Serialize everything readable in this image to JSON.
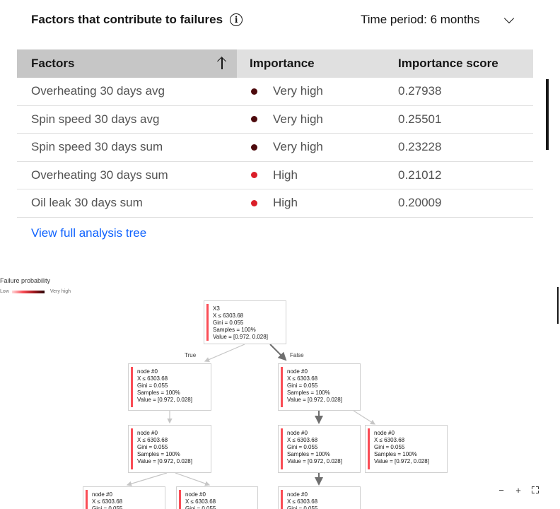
{
  "card": {
    "title": "Factors that contribute to failures",
    "info_glyph": "i",
    "period_label": "Time period: 6 months"
  },
  "table": {
    "headers": {
      "factors": "Factors",
      "importance": "Importance",
      "score": "Importance score"
    },
    "rows": [
      {
        "factor": "Overheating 30 days avg",
        "importance": "Very high",
        "score": "0.27938",
        "dot_color": "#4d0a0d"
      },
      {
        "factor": "Spin speed 30 days avg",
        "importance": "Very high",
        "score": "0.25501",
        "dot_color": "#4d0a0d"
      },
      {
        "factor": "Spin speed 30 days sum",
        "importance": "Very high",
        "score": "0.23228",
        "dot_color": "#4d0a0d"
      },
      {
        "factor": "Overheating 30 days sum",
        "importance": "High",
        "score": "0.21012",
        "dot_color": "#da1e28"
      },
      {
        "factor": "Oil leak 30 days sum",
        "importance": "High",
        "score": "0.20009",
        "dot_color": "#da1e28"
      }
    ]
  },
  "link_text": "View full analysis tree",
  "legend": {
    "title": "Failure probability",
    "low": "Low",
    "high": "Very high"
  },
  "tree": {
    "edge_true": "True",
    "edge_false": "False",
    "root": {
      "title": "X3",
      "split": "X ≤ 6303.68",
      "gini": "Gini = 0.055",
      "samples": "Samples = 100%",
      "value": "Value = [0.972, 0.028]"
    },
    "node": {
      "title": "node #0",
      "split": "X ≤ 6303.68",
      "gini": "Gini = 0.055",
      "samples": "Samples = 100%",
      "value": "Value = [0.972, 0.028]"
    }
  },
  "zoom": {
    "minus": "−",
    "plus": "+"
  },
  "colors": {
    "link": "#0f62fe",
    "node_bar": "#fa4d56",
    "header_bg": "#e0e0e0",
    "sorted_header_bg": "#c6c6c6"
  }
}
